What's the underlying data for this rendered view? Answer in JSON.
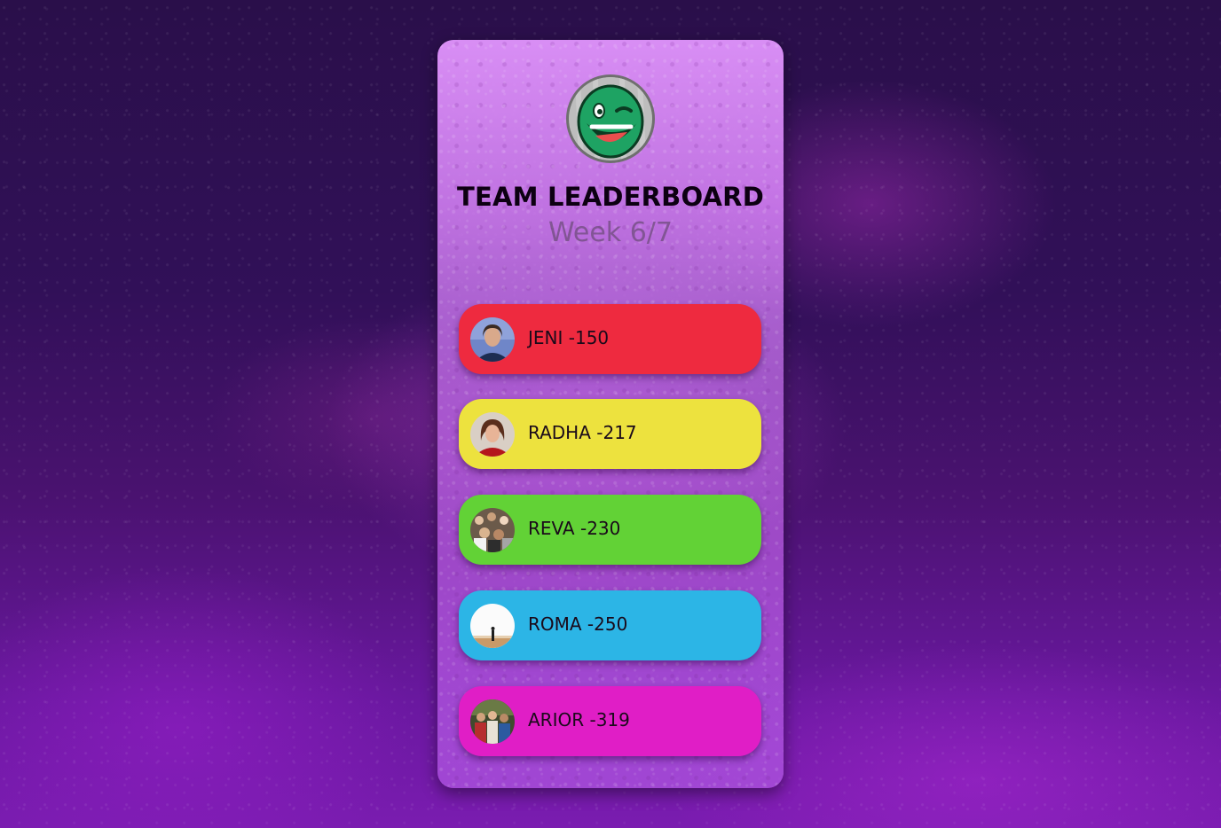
{
  "leaderboard": {
    "title": "TEAM LEADERBOARD",
    "subtitle": "Week 6/7",
    "logo_icon": "winking-smiley-logo",
    "players": [
      {
        "name": "JENI",
        "score": "150",
        "color": "#ee2a3f",
        "avatar_icon": "woman-portrait-avatar"
      },
      {
        "name": "RADHA",
        "score": "217",
        "color": "#ede23e",
        "avatar_icon": "woman-red-top-avatar"
      },
      {
        "name": "REVA",
        "score": "230",
        "color": "#62d236",
        "avatar_icon": "crowd-photo-avatar"
      },
      {
        "name": "ROMA",
        "score": "250",
        "color": "#2cb5e6",
        "avatar_icon": "silhouette-sunset-avatar"
      },
      {
        "name": "ARIOR",
        "score": "319",
        "color": "#e01ec6",
        "avatar_icon": "group-photo-avatar"
      }
    ]
  }
}
